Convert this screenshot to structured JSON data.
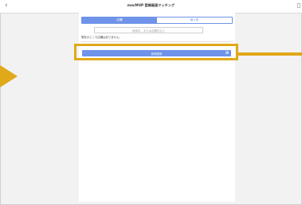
{
  "header": {
    "back_glyph": "‹",
    "title": "macMUP 登録画面マッチング"
  },
  "tabs": [
    {
      "label": "店舗",
      "active": true
    },
    {
      "label": "個人別",
      "active": false
    }
  ],
  "search": {
    "placeholder": "検索名、または店舗名など"
  },
  "notice": "現在のところ店舗はありません。",
  "action_button": {
    "label": "新規登録",
    "icon": "plus-circle-icon"
  },
  "colors": {
    "accent": "#6f93e8",
    "highlight": "#e0a91a"
  }
}
